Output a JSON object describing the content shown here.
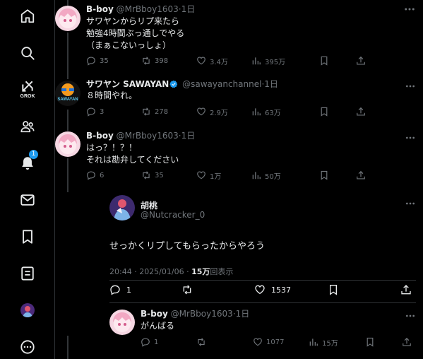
{
  "nav": {
    "grok_label": "GROK",
    "notification_count": "1"
  },
  "tweets": [
    {
      "name": "B-boy",
      "handle": "@MrBboy1603",
      "time": "1日",
      "lines": [
        "サワヤンからリプ来たら",
        "勉強4時間ぶっ通しでやる",
        "（まぁこないっしょ）"
      ],
      "replies": "35",
      "reposts": "",
      "reposts_text": "398",
      "likes": "3.4万",
      "views": "395万"
    },
    {
      "name": "サワヤン SAWAYAN",
      "handle": "@sawayanchannel",
      "time": "1日",
      "verified": true,
      "lines": [
        "８時間やれ。"
      ],
      "replies": "3",
      "reposts_text": "278",
      "likes": "2.9万",
      "views": "63万"
    },
    {
      "name": "B-boy",
      "handle": "@MrBboy1603",
      "time": "1日",
      "lines": [
        "はっ？！？！",
        "それは勘弁してください"
      ],
      "replies": "6",
      "reposts_text": "35",
      "likes": "1万",
      "views": "50万"
    }
  ],
  "main_tweet": {
    "name": "胡桃",
    "handle": "@Nutcracker_0",
    "text": "せっかくリプしてもらったからやろう",
    "datetime": "20:44 · 2025/01/06 · ",
    "views_count": "15万",
    "views_label": "回表示",
    "replies": "1",
    "likes": "1537"
  },
  "reply": {
    "name": "B-boy",
    "handle": "@MrBboy1603",
    "time": "1日",
    "lines": [
      "がんばる"
    ],
    "replies": "1",
    "likes": "1077",
    "views": "15万"
  },
  "colors": {
    "background": "#000000",
    "text": "#e7e9ea",
    "muted": "#71767b",
    "accent": "#1d9bf0"
  }
}
